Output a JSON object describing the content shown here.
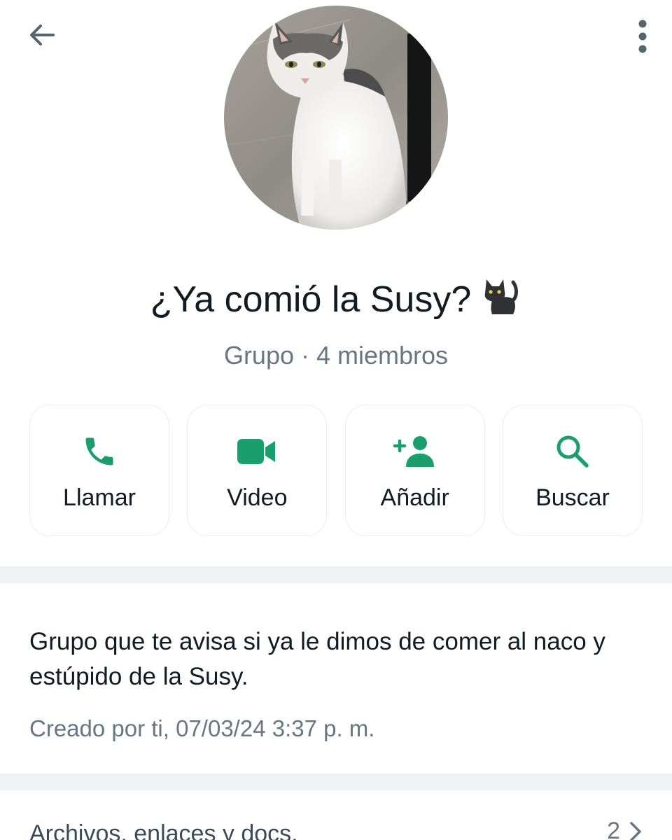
{
  "header": {
    "back_icon": "arrow-back-icon",
    "menu_icon": "more-vertical-icon"
  },
  "group": {
    "name": "¿Ya comió la Susy?",
    "name_emoji": "black-cat-emoji",
    "subtitle": "Grupo · 4 miembros",
    "avatar": "cat-photo"
  },
  "actions": [
    {
      "label": "Llamar",
      "icon": "phone-icon"
    },
    {
      "label": "Video",
      "icon": "video-camera-icon"
    },
    {
      "label": "Añadir",
      "icon": "add-person-icon"
    },
    {
      "label": "Buscar",
      "icon": "search-icon"
    }
  ],
  "description": {
    "text": "Grupo que te avisa si ya le dimos de comer al naco y estúpido de la Susy.",
    "created": "Creado por ti, 07/03/24 3:37 p. m."
  },
  "media": {
    "label": "Archivos, enlaces y docs.",
    "count": "2"
  },
  "colors": {
    "accent": "#1a9e6e",
    "text_primary": "#111b21",
    "text_secondary": "#667781",
    "divider": "#f0f2f5"
  }
}
